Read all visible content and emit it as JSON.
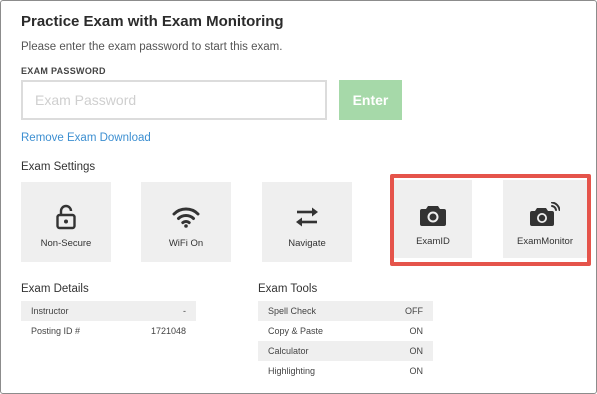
{
  "header": {
    "title": "Practice Exam with Exam Monitoring",
    "subtitle": "Please enter the exam password to start this exam."
  },
  "password": {
    "label": "EXAM PASSWORD",
    "placeholder": "Exam Password",
    "value": "",
    "enter_label": "Enter"
  },
  "remove_download": "Remove Exam Download",
  "settings": {
    "heading": "Exam Settings",
    "tiles": [
      {
        "label": "Non-Secure",
        "icon": "unlocked-padlock-icon"
      },
      {
        "label": "WiFi On",
        "icon": "wifi-icon"
      },
      {
        "label": "Navigate",
        "icon": "swap-arrows-icon"
      },
      {
        "label": "ExamID",
        "icon": "camera-icon"
      },
      {
        "label": "ExamMonitor",
        "icon": "camera-monitor-icon"
      }
    ],
    "highlight_color": "#e5544b"
  },
  "details": {
    "heading": "Exam Details",
    "rows": [
      {
        "label": "Instructor",
        "value": "-"
      },
      {
        "label": "Posting ID #",
        "value": "1721048"
      }
    ]
  },
  "tools": {
    "heading": "Exam Tools",
    "rows": [
      {
        "label": "Spell Check",
        "value": "OFF"
      },
      {
        "label": "Copy & Paste",
        "value": "ON"
      },
      {
        "label": "Calculator",
        "value": "ON"
      },
      {
        "label": "Highlighting",
        "value": "ON"
      }
    ]
  },
  "colors": {
    "enter_button": "#a6d9a9",
    "link": "#3d8fd1",
    "tile_bg": "#efefef"
  }
}
